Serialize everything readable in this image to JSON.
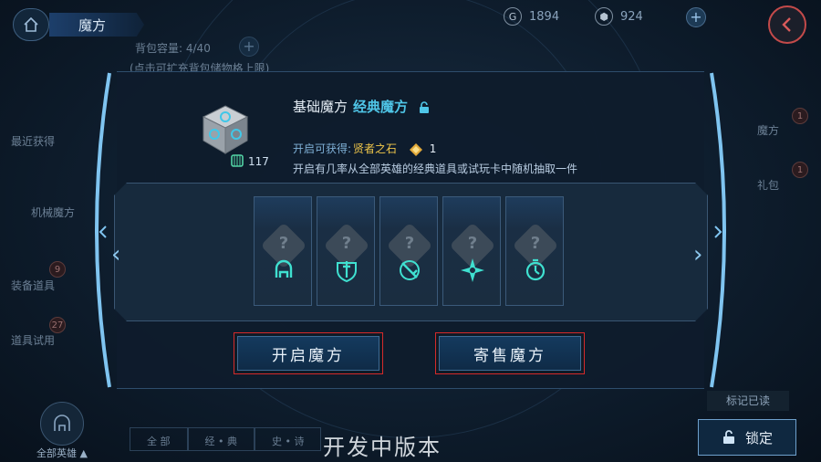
{
  "header": {
    "title": "魔方",
    "gold": "1894",
    "gold_icon_label": "G",
    "gems": "924"
  },
  "background": {
    "capacity_label": "背包容量:",
    "capacity_value": "4/40",
    "expand_hint": "(点击可扩充背包储物格上限)",
    "sidebar_items": [
      {
        "label": "最近获得",
        "badge": ""
      },
      {
        "label": "机械魔方",
        "badge": ""
      },
      {
        "label": "装备道具",
        "badge": "9"
      },
      {
        "label": "道具试用",
        "badge": "27"
      }
    ],
    "right_tabs": [
      {
        "label": "魔方",
        "badge": "1"
      },
      {
        "label": "礼包",
        "badge": "1"
      }
    ],
    "bottom_tabs": [
      "全  部",
      "经 • 典",
      "史 • 诗"
    ],
    "all_heroes": "全部英雄",
    "mark_read": "标记已读",
    "lock": "锁定"
  },
  "modal": {
    "title_prefix": "基础魔方",
    "title_highlight": "经典魔方",
    "cube_count": "117",
    "reward_label": "开启可获得:",
    "reward_item": "贤者之石",
    "reward_count": "1",
    "description": "开启有几率从全部英雄的经典道具或试玩卡中随机抽取一件",
    "cards": [
      {
        "symbol": "helmet-icon",
        "mark": "?"
      },
      {
        "symbol": "sword-shield-icon",
        "mark": "?"
      },
      {
        "symbol": "crossed-sword-icon",
        "mark": "?"
      },
      {
        "symbol": "star-burst-icon",
        "mark": "?"
      },
      {
        "symbol": "clock-icon",
        "mark": "?"
      }
    ],
    "open_button": "开启魔方",
    "sell_button": "寄售魔方"
  },
  "watermark": "开发中版本",
  "colors": {
    "accent": "#4fc6e8",
    "button_border": "#d52a2a",
    "gold": "#f0c74a"
  }
}
